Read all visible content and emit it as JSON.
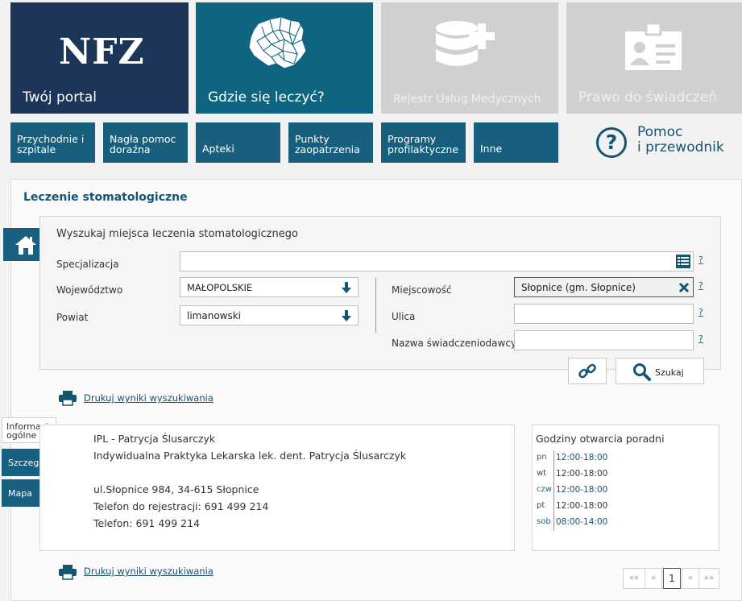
{
  "tiles": {
    "portal": {
      "logo": "NFZ",
      "label": "Twój portal"
    },
    "gdzie": {
      "label": "Gdzie się leczyć?"
    },
    "rum": {
      "label": "Rejestr Usług Medycznych"
    },
    "prawo": {
      "label": "Prawo do świadczeń"
    }
  },
  "subtiles": [
    "Przychodnie i szpitale",
    "Nagła pomoc doraźna",
    "Apteki",
    "Punkty zaopatrzenia",
    "Programy profilaktyczne",
    "Inne"
  ],
  "help": {
    "label": "Pomoc i przewodnik",
    "line1": "Pomoc",
    "line2": "i przewodnik",
    "glyph": "?"
  },
  "page_title": "Leczenie stomatologiczne",
  "search": {
    "title": "Wyszukaj miejsca leczenia stomatologicznego",
    "specjalizacja_label": "Specjalizacja",
    "specjalizacja_value": "",
    "wojewodztwo_label": "Województwo",
    "wojewodztwo_value": "MAŁOPOLSKIE",
    "powiat_label": "Powiat",
    "powiat_value": "limanowski",
    "miejscowosc_label": "Miejscowość",
    "miejscowosc_value": "Słopnice (gm. Słopnice)",
    "ulica_label": "Ulica",
    "ulica_value": "",
    "nazwa_label": "Nazwa świadczeniodawcy",
    "nazwa_value": "",
    "help_mark": "?",
    "search_button": "Szukaj"
  },
  "print_link": "Drukuj wyniki wyszukiwania",
  "side_tabs": [
    "Informacje ogólne",
    "Szczegóły",
    "Mapa"
  ],
  "provider": {
    "line1": "IPL - Patrycja Ślusarczyk",
    "line2": "Indywidualna Praktyka Lekarska lek. dent. Patrycja Ślusarczyk",
    "address": "ul.Słopnice 984, 34-615 Słopnice",
    "phone_registration": "Telefon do rejestracji: 691 499 214",
    "phone": "Telefon: 691 499 214"
  },
  "hours": {
    "title": "Godziny otwarcia poradni",
    "rows": [
      {
        "day": "pn",
        "time": "12:00-18:00"
      },
      {
        "day": "wt",
        "time": "12:00-18:00"
      },
      {
        "day": "czw",
        "time": "12:00-18:00"
      },
      {
        "day": "pt",
        "time": "12:00-18:00"
      },
      {
        "day": "sob",
        "time": "08:00-14:00"
      }
    ]
  },
  "pager": {
    "first": "««",
    "prev": "«",
    "current": "1",
    "next": "»",
    "last": "»»"
  },
  "colors": {
    "navy": "#1d3559",
    "teal": "#0f6580",
    "link": "#145574",
    "grey_tile": "#d0d0d0"
  }
}
